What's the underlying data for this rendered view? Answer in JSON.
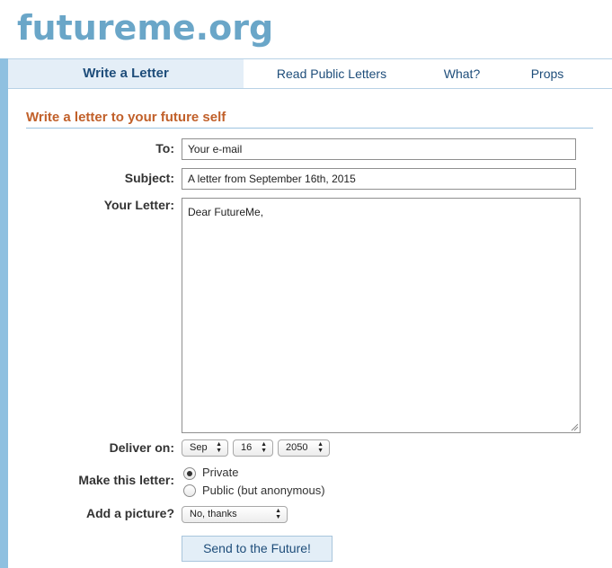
{
  "site": {
    "logo": "futureme.org"
  },
  "nav": {
    "tabs": [
      "Write a Letter",
      "Read Public Letters",
      "What?",
      "Props"
    ],
    "active": 0
  },
  "form": {
    "section_title": "Write a letter to your future self",
    "to": {
      "label": "To:",
      "value": "Your e-mail"
    },
    "subject": {
      "label": "Subject:",
      "value": "A letter from September 16th, 2015"
    },
    "letter": {
      "label": "Your Letter:",
      "value": "Dear FutureMe,"
    },
    "deliver": {
      "label": "Deliver on:",
      "month": "Sep",
      "day": "16",
      "year": "2050"
    },
    "privacy": {
      "label": "Make this letter:",
      "options": [
        "Private",
        "Public (but anonymous)"
      ],
      "selected": 0
    },
    "picture": {
      "label": "Add a picture?",
      "value": "No, thanks"
    },
    "submit": "Send to the Future!"
  },
  "colors": {
    "accent": "#c1602a",
    "link": "#1e4d7a",
    "sidebar": "#8fc0e0",
    "logo": "#6aa6c8"
  }
}
